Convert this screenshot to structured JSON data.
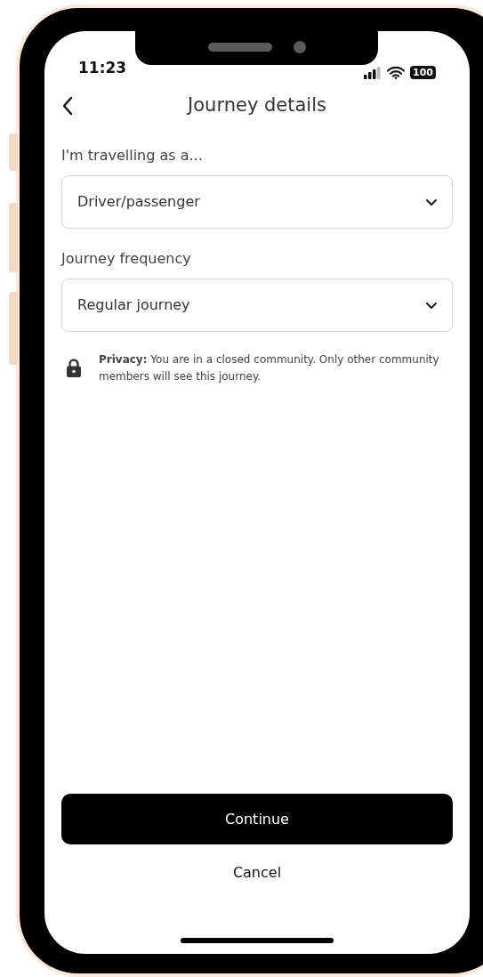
{
  "status_bar": {
    "time": "11:23",
    "battery": "100"
  },
  "header": {
    "title": "Journey details"
  },
  "fields": [
    {
      "label": "I'm travelling as a...",
      "value": "Driver/passenger"
    },
    {
      "label": "Journey frequency",
      "value": "Regular journey"
    }
  ],
  "privacy": {
    "text": "**Privacy:** You are in a closed community. Only other community members will see this journey."
  },
  "buttons": [
    {
      "label": "Continue",
      "kind": "primary"
    },
    {
      "label": "Cancel",
      "kind": "text"
    }
  ]
}
